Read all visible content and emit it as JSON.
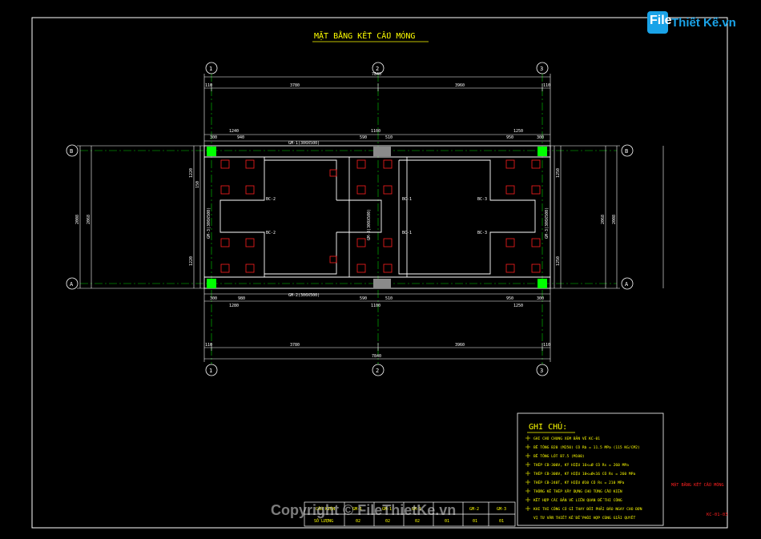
{
  "title": "MẶT BẰNG KẾT CẤU MÓNG",
  "logo": {
    "file": "File",
    "rest": "Thiết Kế.vn"
  },
  "watermark": "Copyright © FileThietKe.vn",
  "axes": {
    "n1": "1",
    "n2": "2",
    "n3": "3",
    "nA": "A",
    "nB": "B"
  },
  "dims": {
    "total": "7840",
    "span_left": "3780",
    "span_right": "3960",
    "edge": "110",
    "top_left": "1240",
    "top_left_a": "300",
    "top_left_b": "940",
    "top_mid": "1100",
    "mid_a": "590",
    "mid_b": "510",
    "top_right": "1250",
    "right_a": "950",
    "right_b": "300",
    "bot_left": "1280",
    "bot_left_b": "980",
    "vert_total": "2008",
    "vert_inner": "2068",
    "vert_seg": "1220",
    "vert_seg2": "1250",
    "vert_small": "150",
    "vert_300": "300"
  },
  "labels": {
    "gm1_top": "GM-1(300X500)",
    "gm1_bot": "GM-2(300X500)",
    "gm3_left": "GM-3(300X500)",
    "gm3_mid": "GM-3(300X500)",
    "gm3_right": "GM-3(300X500)",
    "bc2": "BC-2",
    "bc1": "BC-1",
    "bc3": "BC-3"
  },
  "notes": {
    "heading": "GHI CHÚ:",
    "items": [
      "GHI CHÚ CHUNG XEM BẢN VẼ KC-01",
      "BÊ TÔNG B20 (M250) CÓ Rb = 11.5 MPa (115 KG/CM2)",
      "BÊ TÔNG LÓT B7.5 (M100)",
      "THÉP CB-300V, KÝ HIỆU 16<=Ø CÓ Rs = 260 MPa",
      "THÉP CB-300V, KÝ HIỆU 10<=Ø<16 CÓ Rs = 260 MPa",
      "THÉP CB-240T, KÝ HIỆU Ø10 CÓ Rs = 210 MPa",
      "THỐNG KÊ THÉP XÂY DỰNG CHO TỪNG CẤU KIỆN",
      "KẾT HỢP CÁC BẢN VẼ LIÊN QUAN ĐỂ THI CÔNG",
      "KHI THI CÔNG CÓ GÌ THAY ĐỔI PHẢI BÁO NGAY CHO ĐƠN",
      "VỊ TƯ VẤN THIẾT KẾ ĐỂ PHỐI HỢP CÙNG GIẢI QUYẾT"
    ]
  },
  "schedule": {
    "row1_label": "CẤU KIỆN",
    "row2_label": "SỐ LƯỢNG",
    "headers": [
      "GM-1",
      "GM-1",
      "GM-1",
      "GM-2",
      "GM-3"
    ],
    "counts": [
      "02",
      "02",
      "02",
      "01",
      "01",
      "01"
    ]
  },
  "side_title": "MẶT BẰNG KẾT CẤU MÓNG",
  "sheet_code": "KC-01-03",
  "colors": {
    "line": "#ffffff",
    "dim": "#00ffff",
    "text": "#ffff00",
    "axis": "#00ff00",
    "red": "#ff2020",
    "green": "#00ff00",
    "gray": "#808080"
  }
}
